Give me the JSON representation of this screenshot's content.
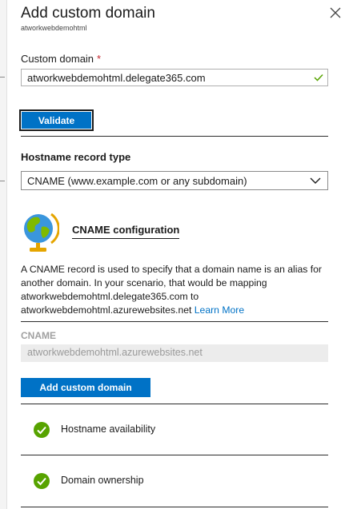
{
  "panel": {
    "title": "Add custom domain",
    "subtitle": "atworkwebdemohtml",
    "close_icon": "close-icon"
  },
  "custom_domain": {
    "label": "Custom domain",
    "required_marker": "*",
    "value": "atworkwebdemohtml.delegate365.com",
    "valid": true
  },
  "validate_button": {
    "label": "Validate"
  },
  "record_type": {
    "label": "Hostname record type",
    "selected": "CNAME (www.example.com or any subdomain)"
  },
  "cname_config": {
    "heading": "CNAME configuration",
    "icon": "globe-icon",
    "description": "A CNAME record is used to specify that a domain name is an alias for another domain. In your scenario, that would be mapping atworkwebdemohtml.delegate365.com to atworkwebdemohtml.azurewebsites.net",
    "learn_more": "Learn More",
    "field_label": "CNAME",
    "field_value": "atworkwebdemohtml.azurewebsites.net"
  },
  "add_button": {
    "label": "Add custom domain"
  },
  "checks": [
    {
      "label": "Hostname availability",
      "status": "success"
    },
    {
      "label": "Domain ownership",
      "status": "success"
    }
  ],
  "colors": {
    "accent": "#0072c6",
    "success": "#57a300",
    "required": "#c4262e"
  }
}
